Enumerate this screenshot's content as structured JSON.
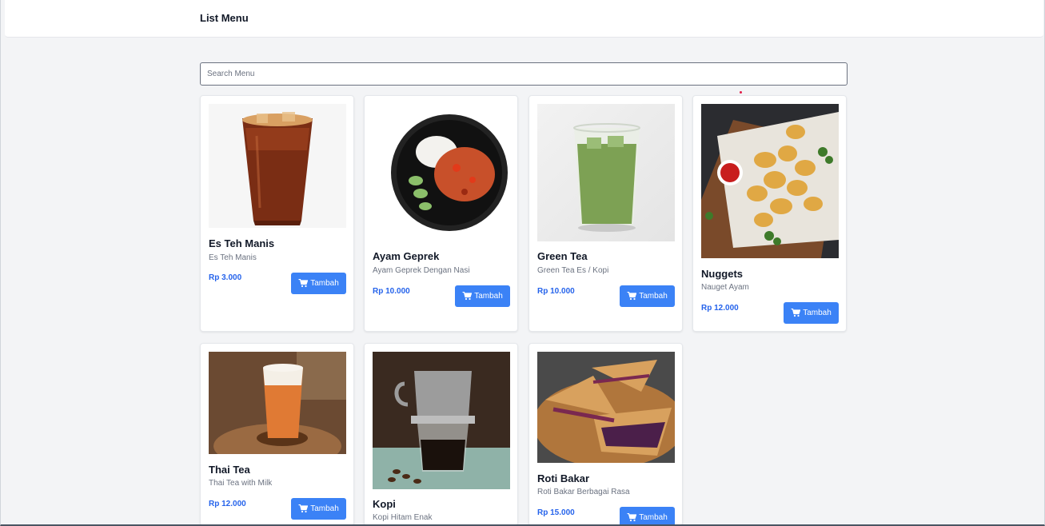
{
  "header": {
    "title": "List Menu"
  },
  "search": {
    "placeholder": "Search Menu"
  },
  "menu": [
    {
      "name": "Es Teh Manis",
      "desc": "Es Teh Manis",
      "price": "Rp 3.000",
      "button": "Tambah"
    },
    {
      "name": "Ayam Geprek",
      "desc": "Ayam Geprek Dengan Nasi",
      "price": "Rp 10.000",
      "button": "Tambah"
    },
    {
      "name": "Green Tea",
      "desc": "Green Tea Es / Kopi",
      "price": "Rp 10.000",
      "button": "Tambah"
    },
    {
      "name": "Nuggets",
      "desc": "Nauget Ayam",
      "price": "Rp 12.000",
      "button": "Tambah"
    },
    {
      "name": "Thai Tea",
      "desc": "Thai Tea with Milk",
      "price": "Rp 12.000",
      "button": "Tambah"
    },
    {
      "name": "Kopi",
      "desc": "Kopi Hitam Enak",
      "price": "",
      "button": ""
    },
    {
      "name": "Roti Bakar",
      "desc": "Roti Bakar Berbagai Rasa",
      "price": "Rp 15.000",
      "button": "Tambah"
    }
  ],
  "colors": {
    "accent": "#3b82f6",
    "price": "#2563eb",
    "background": "#f3f4f6"
  },
  "icons": {
    "cart": "shopping-cart-icon"
  }
}
